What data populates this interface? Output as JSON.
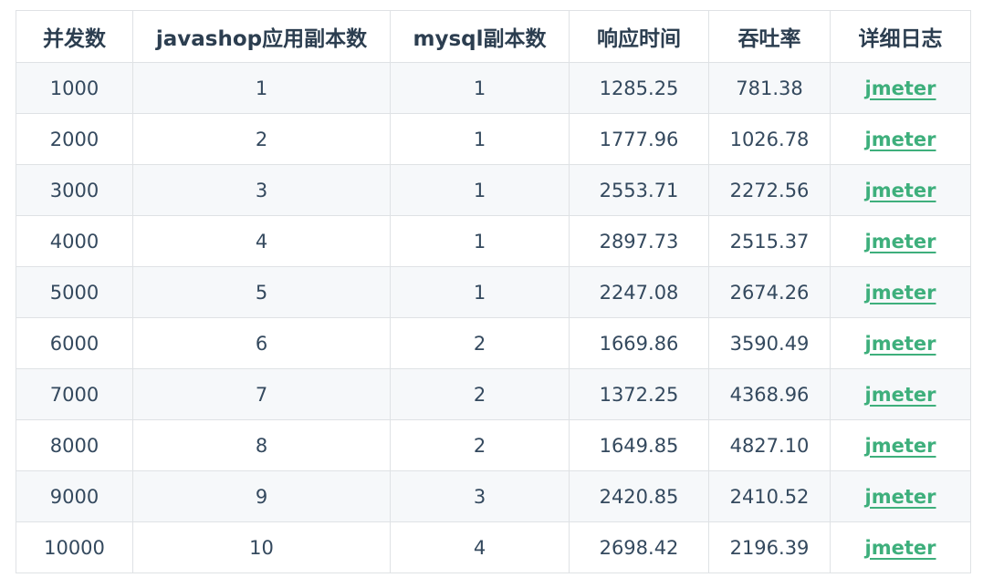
{
  "table": {
    "headers": [
      "并发数",
      "javashop应用副本数",
      "mysql副本数",
      "响应时间",
      "吞吐率",
      "详细日志"
    ],
    "link_color": "#3eaf7c",
    "rows": [
      {
        "concurrency": "1000",
        "app_replicas": "1",
        "mysql_replicas": "1",
        "response_time": "1285.25",
        "throughput": "781.38",
        "log": "jmeter"
      },
      {
        "concurrency": "2000",
        "app_replicas": "2",
        "mysql_replicas": "1",
        "response_time": "1777.96",
        "throughput": "1026.78",
        "log": "jmeter"
      },
      {
        "concurrency": "3000",
        "app_replicas": "3",
        "mysql_replicas": "1",
        "response_time": "2553.71",
        "throughput": "2272.56",
        "log": "jmeter"
      },
      {
        "concurrency": "4000",
        "app_replicas": "4",
        "mysql_replicas": "1",
        "response_time": "2897.73",
        "throughput": "2515.37",
        "log": "jmeter"
      },
      {
        "concurrency": "5000",
        "app_replicas": "5",
        "mysql_replicas": "1",
        "response_time": "2247.08",
        "throughput": "2674.26",
        "log": "jmeter"
      },
      {
        "concurrency": "6000",
        "app_replicas": "6",
        "mysql_replicas": "2",
        "response_time": "1669.86",
        "throughput": "3590.49",
        "log": "jmeter"
      },
      {
        "concurrency": "7000",
        "app_replicas": "7",
        "mysql_replicas": "2",
        "response_time": "1372.25",
        "throughput": "4368.96",
        "log": "jmeter"
      },
      {
        "concurrency": "8000",
        "app_replicas": "8",
        "mysql_replicas": "2",
        "response_time": "1649.85",
        "throughput": "4827.10",
        "log": "jmeter"
      },
      {
        "concurrency": "9000",
        "app_replicas": "9",
        "mysql_replicas": "3",
        "response_time": "2420.85",
        "throughput": "2410.52",
        "log": "jmeter"
      },
      {
        "concurrency": "10000",
        "app_replicas": "10",
        "mysql_replicas": "4",
        "response_time": "2698.42",
        "throughput": "2196.39",
        "log": "jmeter"
      }
    ]
  }
}
